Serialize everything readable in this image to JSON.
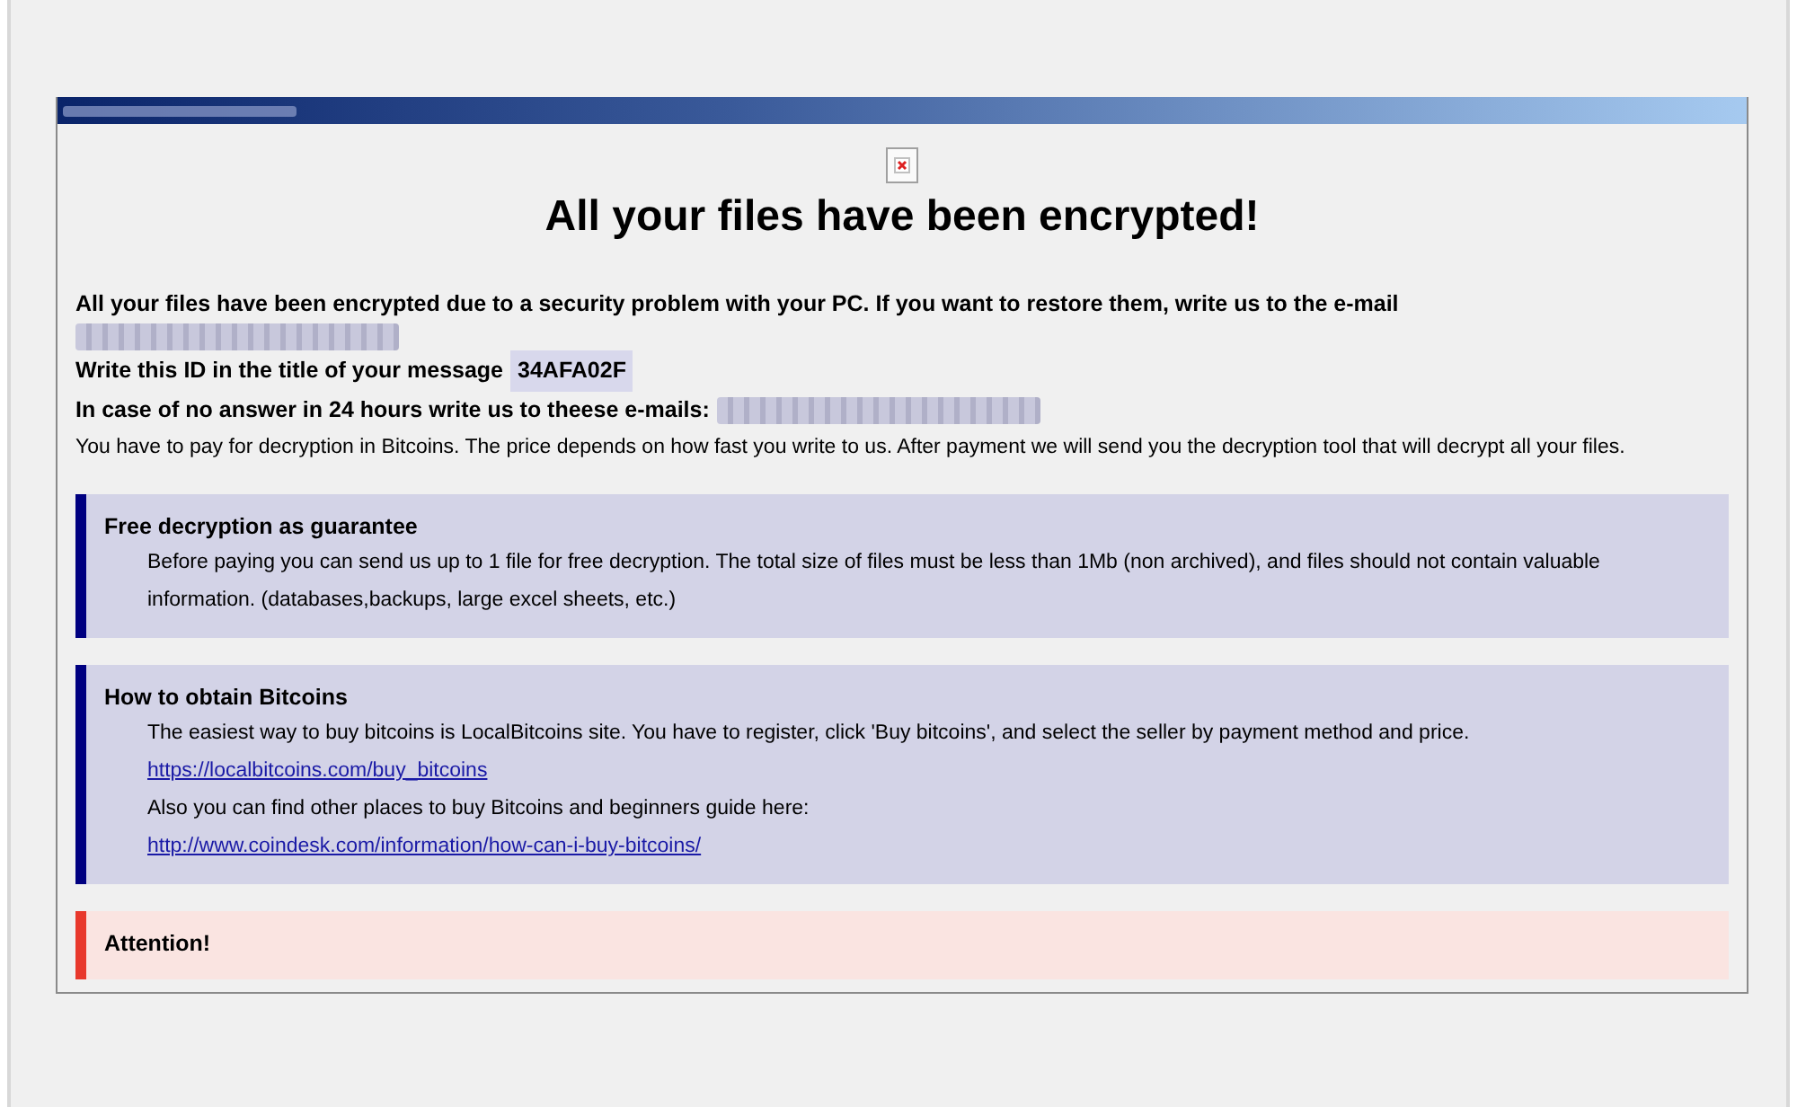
{
  "heading": "All your files have been encrypted!",
  "lines": [
    {
      "kind": "bold",
      "text": "All your files have been encrypted due to a security problem with your PC. If you want to restore them, write us to the e-mail"
    },
    {
      "kind": "redacted"
    },
    {
      "kind": "id",
      "text": "Write this ID in the title of your message",
      "value": "34AFA02F"
    },
    {
      "kind": "bold_redacted",
      "text": "In case of no answer in 24 hours write us to theese e-mails:"
    },
    {
      "kind": "plain",
      "text": "You have to pay for decryption in Bitcoins. The price depends on how fast you write to us. After payment we will send you the decryption tool that will decrypt all your files."
    }
  ],
  "sections": [
    {
      "kind": "info",
      "title": "Free decryption as guarantee",
      "paragraphs": [
        {
          "kind": "text",
          "text": "Before paying you can send us up to 1 file for free decryption. The total size of files must be less than 1Mb (non archived), and files should not contain valuable information. (databases,backups, large excel sheets, etc.)"
        }
      ]
    },
    {
      "kind": "info",
      "title": "How to obtain Bitcoins",
      "paragraphs": [
        {
          "kind": "text",
          "text": "The easiest way to buy bitcoins is LocalBitcoins site. You have to register, click 'Buy bitcoins', and select the seller by payment method and price."
        },
        {
          "kind": "link",
          "text": "https://localbitcoins.com/buy_bitcoins"
        },
        {
          "kind": "text",
          "text": "Also you can find other places to buy Bitcoins and beginners guide here:"
        },
        {
          "kind": "link",
          "text": "http://www.coindesk.com/information/how-can-i-buy-bitcoins/"
        }
      ]
    },
    {
      "kind": "warning",
      "title": "Attention!"
    }
  ]
}
